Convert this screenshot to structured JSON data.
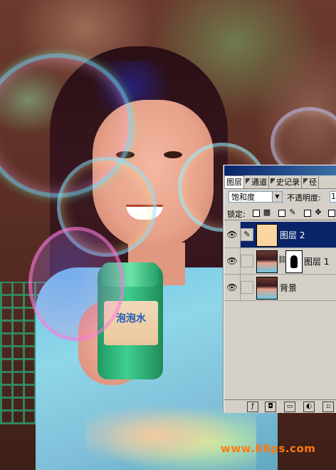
{
  "canvas": {
    "bottle_label_text": "泡泡水",
    "watermark": "www.68ps.com"
  },
  "layers_panel": {
    "tabs": [
      {
        "label": "图层",
        "active": true
      },
      {
        "label": "通道",
        "active": false
      },
      {
        "label": "历史记录",
        "active": false
      },
      {
        "label": "路径",
        "active": false
      }
    ],
    "tab_labels_display": [
      "图层",
      "通道",
      "史记录",
      "径"
    ],
    "blend_mode": "饱和度",
    "opacity_label": "不透明度:",
    "opacity_value": "1",
    "lock_label": "锁定:",
    "layers": [
      {
        "name": "图层 2",
        "selected": true,
        "visible": true,
        "thumbnail": "fill-color",
        "thumbnail_color": "#f9d59f",
        "has_mask": false,
        "linked_brush": true
      },
      {
        "name": "图层 1",
        "selected": false,
        "visible": true,
        "thumbnail": "photo",
        "has_mask": true
      },
      {
        "name": "背景",
        "selected": false,
        "visible": true,
        "thumbnail": "photo",
        "has_mask": false
      }
    ],
    "bottom_buttons": [
      "layer-style-icon",
      "add-mask-icon",
      "new-group-icon",
      "adjustment-layer-icon",
      "new-layer-icon"
    ]
  },
  "colors": {
    "selected_row": "#0a246a",
    "panel_bg": "#d4d0c8",
    "fill_swatch": "#f9d59f",
    "watermark": "#ff7a10"
  }
}
